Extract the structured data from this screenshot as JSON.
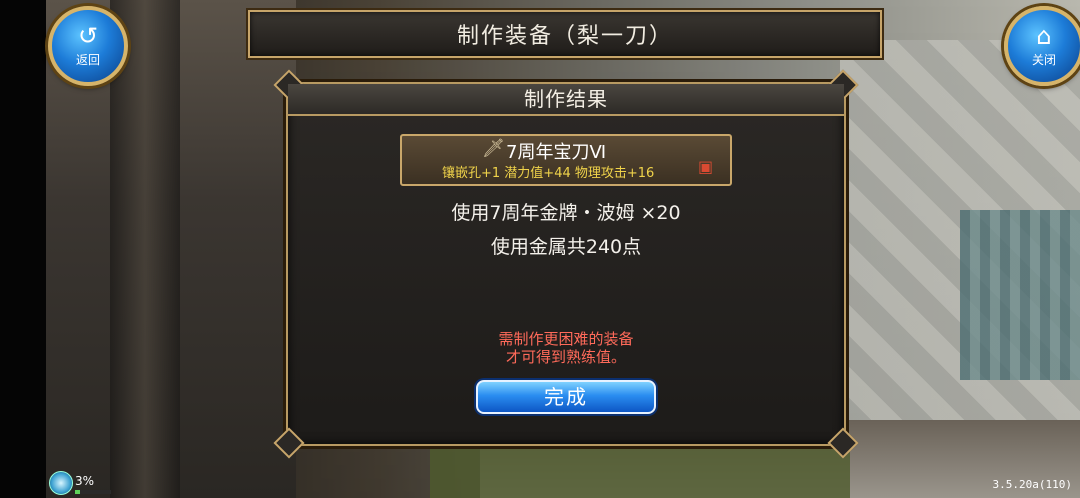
{
  "header": {
    "title": "制作装备（梨一刀）"
  },
  "nav": {
    "back": {
      "label": "返回",
      "icon": "back-arrow-icon"
    },
    "close": {
      "label": "关闭",
      "icon": "home-icon"
    }
  },
  "panel": {
    "title": "制作结果",
    "item": {
      "icon": "sword-icon",
      "name": "7周年宝刀Ⅵ",
      "stats": "镶嵌孔+1 潜力值+44 物理攻击+16",
      "badge_icon": "treasure-chest-icon"
    },
    "materials": [
      "使用7周年金牌・波姆 ×20",
      "使用金属共240点"
    ],
    "hint_lines": [
      "需制作更困难的装备",
      "才可得到熟练值。"
    ],
    "done_label": "完成"
  },
  "status": {
    "percent": "3%",
    "exp_fraction": 0.03,
    "version": "3.5.20a(110)"
  },
  "colors": {
    "frame_gold": "#c7a56a",
    "stats_yellow": "#f0d34a",
    "hint_red": "#ff6a5a",
    "button_blue": "#2a8df0"
  }
}
